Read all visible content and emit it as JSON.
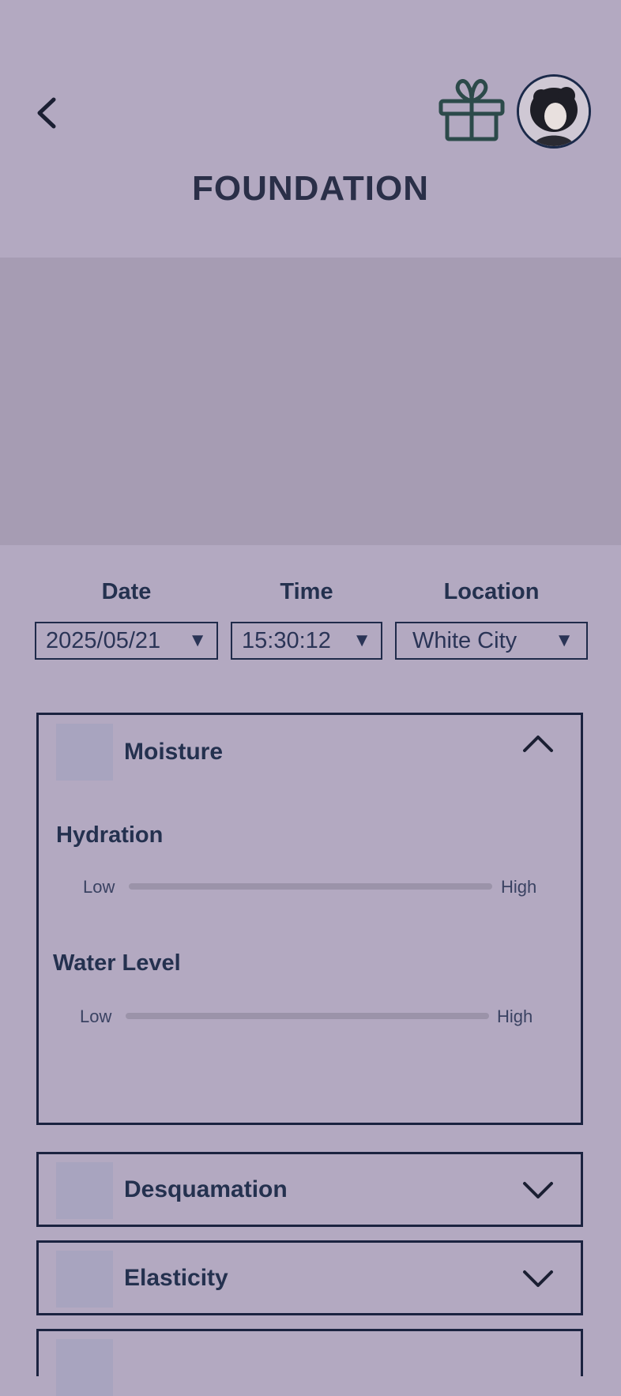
{
  "header": {
    "title": "FOUNDATION",
    "back_icon": "chevron-left-icon",
    "gift_icon": "gift-icon",
    "avatar_icon": "avatar"
  },
  "filters": {
    "date": {
      "label": "Date",
      "value": "2025/05/21"
    },
    "time": {
      "label": "Time",
      "value": "15:30:12"
    },
    "location": {
      "label": "Location",
      "value": "White City"
    }
  },
  "panels": {
    "moisture": {
      "title": "Moisture",
      "expanded": true,
      "metrics": [
        {
          "label": "Hydration",
          "low": "Low",
          "high": "High"
        },
        {
          "label": "Water Level",
          "low": "Low",
          "high": "High"
        }
      ]
    },
    "desquamation": {
      "title": "Desquamation",
      "expanded": false
    },
    "elasticity": {
      "title": "Elasticity",
      "expanded": false
    }
  },
  "colors": {
    "background": "#b3a9c1",
    "banner": "#a69cb3",
    "border": "#1b2340",
    "text": "#24314f"
  }
}
